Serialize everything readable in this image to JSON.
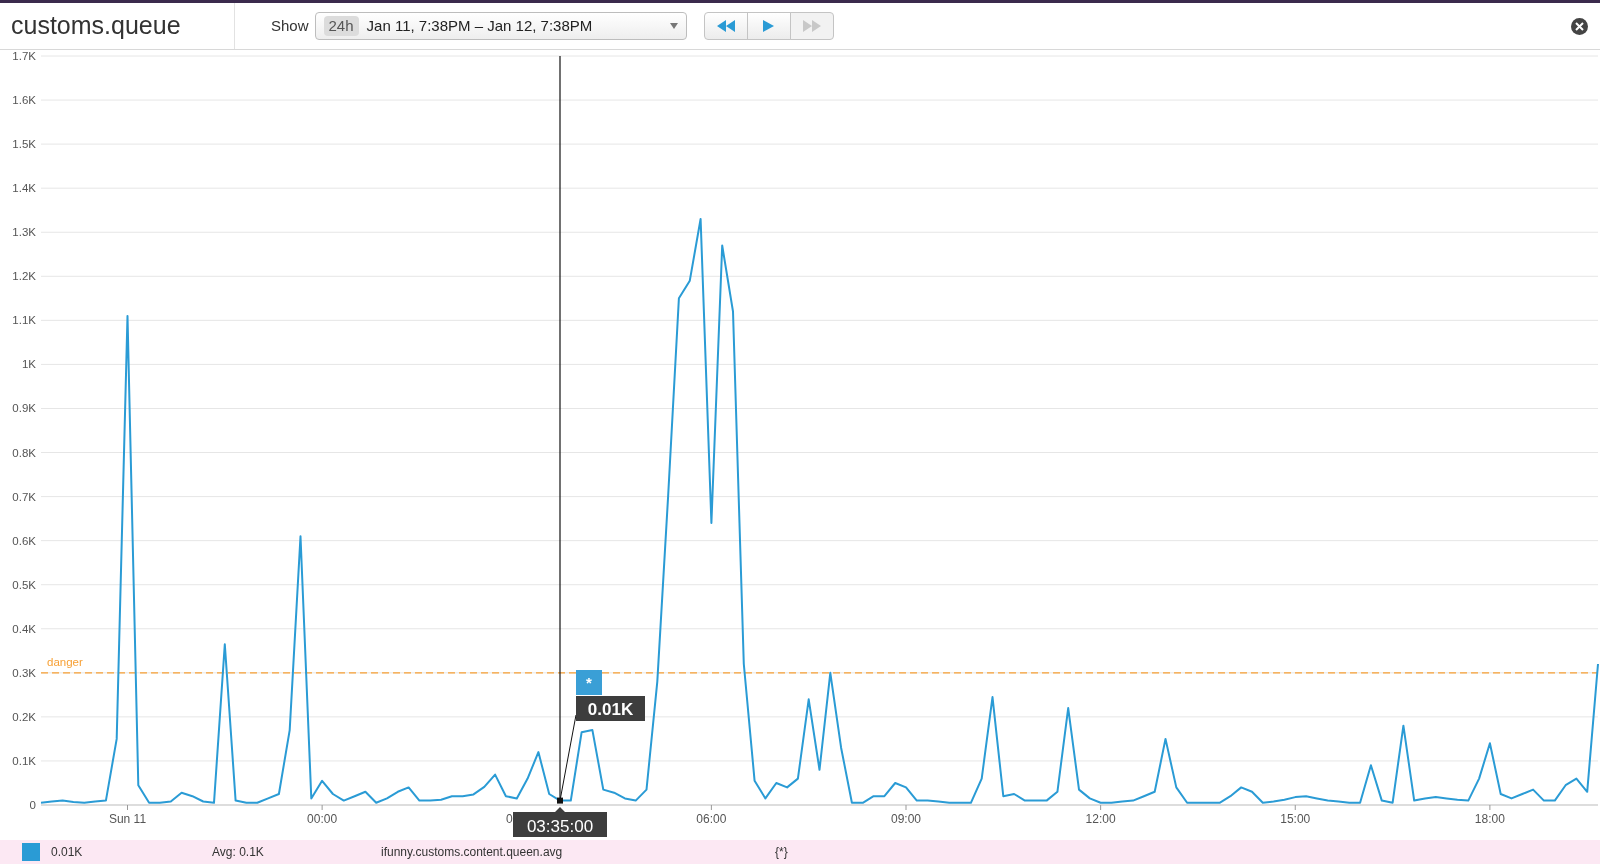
{
  "title": "customs.queue",
  "toolbar": {
    "show_label": "Show",
    "range": {
      "badge": "24h",
      "text": "Jan 11, 7:38PM – Jan 12, 7:38PM"
    },
    "buttons": [
      {
        "kind": "rewind",
        "disabled": false
      },
      {
        "kind": "play",
        "disabled": false
      },
      {
        "kind": "forward",
        "disabled": true
      }
    ]
  },
  "chart": {
    "chart_data": {
      "type": "line",
      "categories": [
        null,
        null,
        null,
        null,
        null,
        null,
        null,
        null,
        "Sun 11",
        null,
        null,
        null,
        null,
        null,
        null,
        null,
        null,
        null,
        null,
        null,
        null,
        null,
        null,
        null,
        null,
        null,
        "00:00",
        null,
        null,
        null,
        null,
        null,
        null,
        null,
        null,
        null,
        null,
        null,
        null,
        null,
        null,
        null,
        null,
        null,
        null,
        null,
        null,
        null,
        null,
        null,
        null,
        null,
        null,
        null,
        null,
        null,
        null,
        null,
        null,
        null,
        null,
        null,
        "06:00",
        null,
        null,
        null,
        null,
        null,
        null,
        null,
        null,
        null,
        null,
        null,
        null,
        null,
        null,
        null,
        null,
        null,
        "09:00",
        null,
        null,
        null,
        null,
        null,
        null,
        null,
        null,
        null,
        null,
        null,
        null,
        null,
        null,
        null,
        null,
        null,
        "12:00",
        null,
        null,
        null,
        null,
        null,
        null,
        null,
        null,
        null,
        null,
        null,
        null,
        null,
        null,
        null,
        null,
        null,
        "15:00",
        null,
        null,
        null,
        null,
        null,
        null,
        null,
        null,
        null,
        null,
        null,
        null,
        null,
        null,
        null,
        null,
        null,
        "18:00",
        null,
        null,
        null,
        null,
        null,
        null,
        null,
        null,
        null,
        null
      ],
      "series": [
        {
          "name": "ifunny.customs.content.queen.avg",
          "color": "#2a9bd5",
          "values": [
            5,
            8,
            10,
            7,
            5,
            8,
            10,
            150,
            1110,
            45,
            5,
            5,
            8,
            28,
            20,
            8,
            5,
            365,
            10,
            5,
            5,
            15,
            25,
            170,
            610,
            15,
            55,
            25,
            10,
            20,
            30,
            5,
            15,
            30,
            40,
            10,
            10,
            12,
            20,
            20,
            24,
            41,
            69,
            20,
            15,
            60,
            120,
            25,
            10,
            10,
            165,
            170,
            35,
            28,
            15,
            10,
            35,
            280,
            700,
            1150,
            1190,
            1330,
            640,
            1270,
            1120,
            320,
            55,
            15,
            50,
            40,
            60,
            240,
            80,
            300,
            130,
            5,
            5,
            20,
            20,
            50,
            40,
            10,
            10,
            8,
            5,
            5,
            5,
            60,
            245,
            20,
            25,
            10,
            10,
            10,
            30,
            220,
            35,
            15,
            5,
            5,
            8,
            10,
            20,
            30,
            150,
            40,
            5,
            5,
            5,
            5,
            20,
            40,
            30,
            5,
            8,
            12,
            18,
            20,
            15,
            10,
            8,
            5,
            5,
            90,
            10,
            5,
            180,
            10,
            15,
            18,
            15,
            12,
            10,
            60,
            140,
            25,
            15,
            25,
            35,
            10,
            10,
            45,
            60,
            30,
            320
          ]
        }
      ],
      "ylim": [
        0,
        1700
      ],
      "yticks": [
        {
          "value": 0,
          "label": "0"
        },
        {
          "value": 100,
          "label": "0.1K"
        },
        {
          "value": 200,
          "label": "0.2K"
        },
        {
          "value": 300,
          "label": "0.3K"
        },
        {
          "value": 400,
          "label": "0.4K"
        },
        {
          "value": 500,
          "label": "0.5K"
        },
        {
          "value": 600,
          "label": "0.6K"
        },
        {
          "value": 700,
          "label": "0.7K"
        },
        {
          "value": 800,
          "label": "0.8K"
        },
        {
          "value": 900,
          "label": "0.9K"
        },
        {
          "value": 1000,
          "label": "1K"
        },
        {
          "value": 1100,
          "label": "1.1K"
        },
        {
          "value": 1200,
          "label": "1.2K"
        },
        {
          "value": 1300,
          "label": "1.3K"
        },
        {
          "value": 1400,
          "label": "1.4K"
        },
        {
          "value": 1500,
          "label": "1.5K"
        },
        {
          "value": 1600,
          "label": "1.6K"
        },
        {
          "value": 1700,
          "label": "1.7K"
        }
      ],
      "grid": true,
      "ref_lines": [
        {
          "axis": "y",
          "value": 300,
          "label": "danger",
          "color": "#f7a035"
        }
      ],
      "annotations": [
        "0.01K"
      ]
    },
    "crosshair": {
      "time_label": "03:35:00",
      "marker": "*",
      "covered_axis_label": "0"
    }
  },
  "legend": [
    {
      "value": "0.01K",
      "avg": "Avg: 0.1K",
      "scope": "{*}"
    }
  ]
}
